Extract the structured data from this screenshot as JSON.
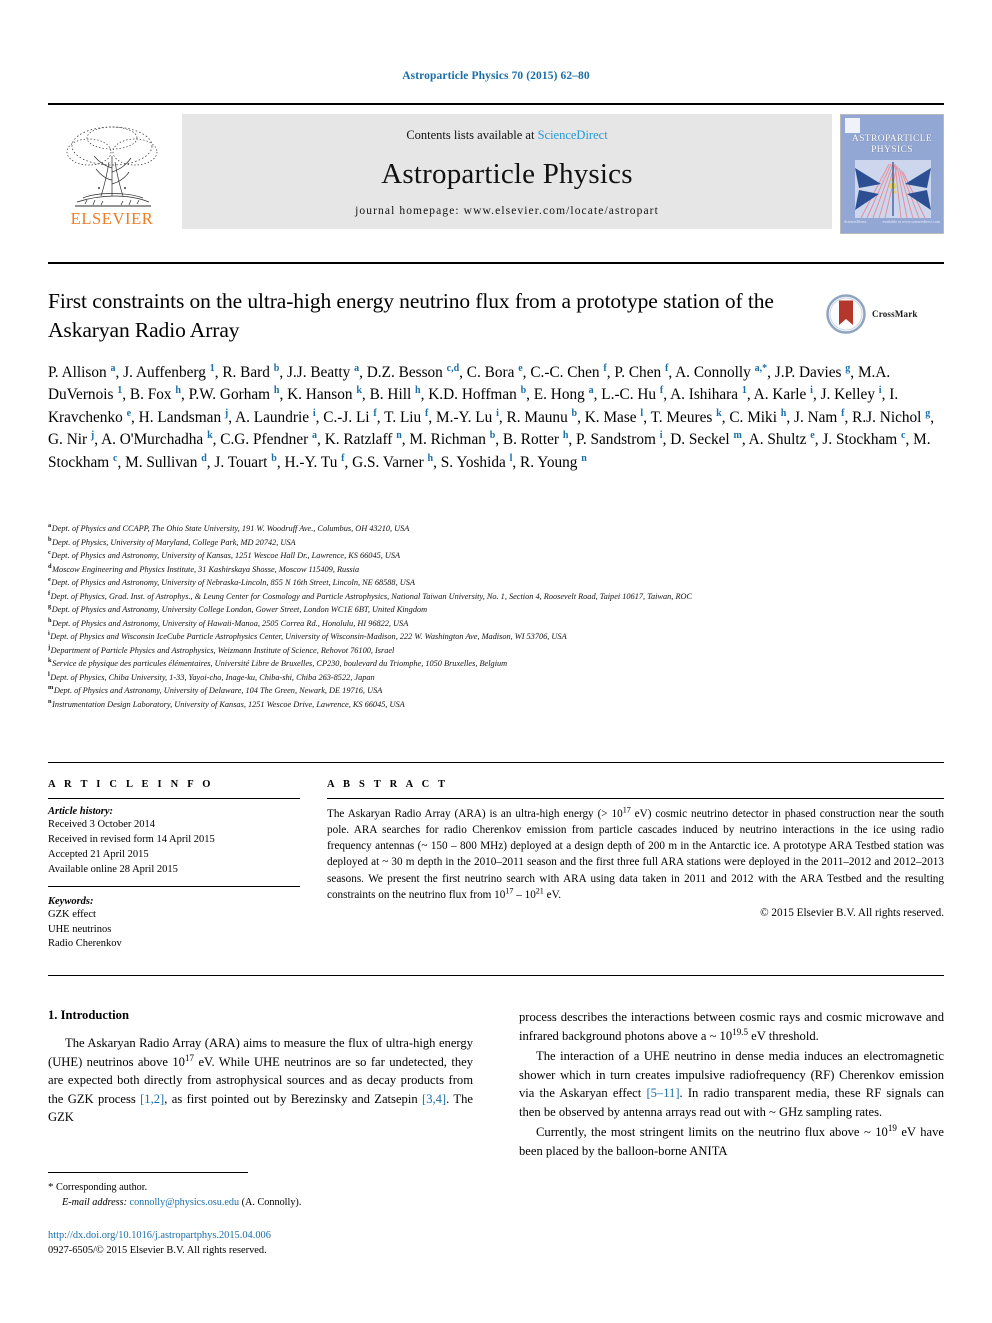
{
  "running_head": "Astroparticle Physics 70 (2015) 62–80",
  "banner": {
    "contents_prefix": "Contents lists available at ",
    "sciencedirect": "ScienceDirect",
    "journal_name": "Astroparticle Physics",
    "homepage": "journal homepage: www.elsevier.com/locate/astropart",
    "publisher_logo_text": "ELSEVIER",
    "cover_title_line1": "ASTROPARTICLE",
    "cover_title_line2": "PHYSICS",
    "cover_footer_left": "ScienceDirect",
    "cover_footer_right": "available at www.sciencedirect.com",
    "accent_color": "#2699d6",
    "elsevier_orange": "#ef7c22"
  },
  "crossmark": {
    "label": "CrossMark",
    "icon": "crossmark-icon"
  },
  "title": "First constraints on the ultra-high energy neutrino flux from a prototype station of the Askaryan Radio Array",
  "authors_html": "P. Allison <sup>a</sup>, J. Auffenberg <sup>1</sup>, R. Bard <sup>b</sup>, J.J. Beatty <sup>a</sup>, D.Z. Besson <sup>c,d</sup>, C. Bora <sup>e</sup>, C.-C. Chen <sup>f</sup>, P. Chen <sup>f</sup>, A. Connolly <sup>a,&#42;</sup>, J.P. Davies <sup>g</sup>, M.A. DuVernois <sup>1</sup>, B. Fox <sup>h</sup>, P.W. Gorham <sup>h</sup>, K. Hanson <sup>k</sup>, B. Hill <sup>h</sup>, K.D. Hoffman <sup>b</sup>, E. Hong <sup>a</sup>, L.-C. Hu <sup>f</sup>, A. Ishihara <sup>1</sup>, A. Karle <sup>i</sup>, J. Kelley <sup>i</sup>, I. Kravchenko <sup>e</sup>, H. Landsman <sup>j</sup>, A. Laundrie <sup>i</sup>, C.-J. Li <sup>f</sup>, T. Liu <sup>f</sup>, M.-Y. Lu <sup>i</sup>, R. Maunu <sup>b</sup>, K. Mase <sup>l</sup>, T. Meures <sup>k</sup>, C. Miki <sup>h</sup>, J. Nam <sup>f</sup>, R.J. Nichol <sup>g</sup>, G. Nir <sup>j</sup>, A. O'Murchadha <sup>k</sup>, C.G. Pfendner <sup>a</sup>, K. Ratzlaff <sup>n</sup>, M. Richman <sup>b</sup>, B. Rotter <sup>h</sup>, P. Sandstrom <sup>i</sup>, D. Seckel <sup>m</sup>, A. Shultz <sup>e</sup>, J. Stockham <sup>c</sup>, M. Stockham <sup>c</sup>, M. Sullivan <sup>d</sup>, J. Touart <sup>b</sup>, H.-Y. Tu <sup>f</sup>, G.S. Varner <sup>h</sup>, S. Yoshida <sup>l</sup>, R. Young <sup>n</sup>",
  "affiliations": [
    {
      "marker": "a",
      "text": "Dept. of Physics and CCAPP, The Ohio State University, 191 W. Woodruff Ave., Columbus, OH 43210, USA"
    },
    {
      "marker": "b",
      "text": "Dept. of Physics, University of Maryland, College Park, MD 20742, USA"
    },
    {
      "marker": "c",
      "text": "Dept. of Physics and Astronomy, University of Kansas, 1251 Wescoe Hall Dr., Lawrence, KS 66045, USA"
    },
    {
      "marker": "d",
      "text": "Moscow Engineering and Physics Institute, 31 Kashirskaya Shosse, Moscow 115409, Russia"
    },
    {
      "marker": "e",
      "text": "Dept. of Physics and Astronomy, University of Nebraska-Lincoln, 855 N 16th Street, Lincoln, NE 68588, USA"
    },
    {
      "marker": "f",
      "text": "Dept. of Physics, Grad. Inst. of Astrophys., & Leung Center for Cosmology and Particle Astrophysics, National Taiwan University, No. 1, Section 4, Roosevelt Road, Taipei 10617, Taiwan, ROC"
    },
    {
      "marker": "g",
      "text": "Dept. of Physics and Astronomy, University College London, Gower Street, London WC1E 6BT, United Kingdom"
    },
    {
      "marker": "h",
      "text": "Dept. of Physics and Astronomy, University of Hawaii-Manoa, 2505 Correa Rd., Honolulu, HI 96822, USA"
    },
    {
      "marker": "i",
      "text": "Dept. of Physics and Wisconsin IceCube Particle Astrophysics Center, University of Wisconsin-Madison, 222 W. Washington Ave, Madison, WI 53706, USA"
    },
    {
      "marker": "j",
      "text": "Department of Particle Physics and Astrophysics, Weizmann Institute of Science, Rehovot 76100, Israel"
    },
    {
      "marker": "k",
      "text": "Service de physique des particules élémentaires, Université Libre de Bruxelles, CP230, boulevard du Triomphe, 1050 Bruxelles, Belgium"
    },
    {
      "marker": "l",
      "text": "Dept. of Physics, Chiba University, 1-33, Yayoi-cho, Inage-ku, Chiba-shi, Chiba 263-8522, Japan"
    },
    {
      "marker": "m",
      "text": "Dept. of Physics and Astronomy, University of Delaware, 104 The Green, Newark, DE 19716, USA"
    },
    {
      "marker": "n",
      "text": "Instrumentation Design Laboratory, University of Kansas, 1251 Wescoe Drive, Lawrence, KS 66045, USA"
    }
  ],
  "article_info": {
    "heading": "A R T I C L E   I N F O",
    "history_label": "Article history:",
    "history": [
      "Received 3 October 2014",
      "Received in revised form 14 April 2015",
      "Accepted 21 April 2015",
      "Available online 28 April 2015"
    ],
    "keywords_label": "Keywords:",
    "keywords": [
      "GZK effect",
      "UHE neutrinos",
      "Radio Cherenkov"
    ]
  },
  "abstract": {
    "heading": "A B S T R A C T",
    "body_html": "The Askaryan Radio Array (ARA) is an ultra-high energy (&gt; 10<sup class=\"num\">17</sup> eV) cosmic neutrino detector in phased construction near the south pole. ARA searches for radio Cherenkov emission from particle cascades induced by neutrino interactions in the ice using radio frequency antennas (&#126; 150 &#8211; 800 MHz) deployed at a design depth of 200 m in the Antarctic ice. A prototype ARA Testbed station was deployed at &#126; 30 m depth in the 2010&#8211;2011 season and the first three full ARA stations were deployed in the 2011&#8211;2012 and 2012&#8211;2013 seasons. We present the first neutrino search with ARA using data taken in 2011 and 2012 with the ARA Testbed and the resulting constraints on the neutrino flux from 10<sup class=\"num\">17</sup> &#8211; 10<sup class=\"num\">21</sup> eV.",
    "rights": "© 2015 Elsevier B.V. All rights reserved."
  },
  "body": {
    "section_heading": "1. Introduction",
    "left_paragraph_html": "The Askaryan Radio Array (ARA) aims to measure the flux of ultra-high energy (UHE) neutrinos above 10<sup class=\"num\">17</sup> eV. While UHE neutrinos are so far undetected, they are expected both directly from astrophysical sources and as decay products from the GZK process <span class=\"ref\">[1,2]</span>, as first pointed out by Berezinsky and Zatsepin <span class=\"ref\">[3,4]</span>. The GZK",
    "right_paragraph_1_html": "process describes the interactions between cosmic rays and cosmic microwave and infrared background photons above a &#126; 10<sup class=\"num\">19.5</sup> eV threshold.",
    "right_paragraph_2_html": "The interaction of a UHE neutrino in dense media induces an electromagnetic shower which in turn creates impulsive radiofrequency (RF) Cherenkov emission via the Askaryan effect <span class=\"ref\">[5&#8211;11]</span>. In radio transparent media, these RF signals can then be observed by antenna arrays read out with &#126; GHz sampling rates.",
    "right_paragraph_3_html": "Currently, the most stringent limits on the neutrino flux above &#126; 10<sup class=\"num\">19</sup> eV have been placed by the balloon-borne ANITA"
  },
  "footnote": {
    "corresponding": "Corresponding author.",
    "email_label": "E-mail address:",
    "email": "connolly@physics.osu.edu",
    "email_owner": "(A. Connolly)."
  },
  "footer": {
    "doi": "http://dx.doi.org/10.1016/j.astropartphys.2015.04.006",
    "issn_line": "0927-6505/© 2015 Elsevier B.V. All rights reserved."
  }
}
